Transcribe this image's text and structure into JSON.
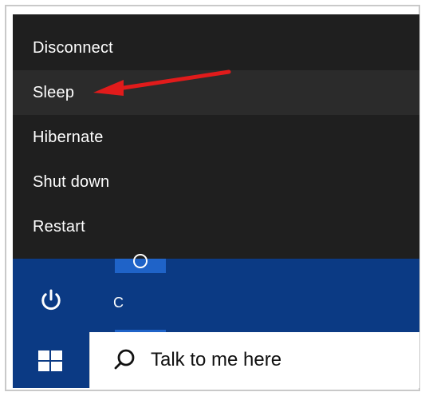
{
  "power_menu": {
    "items": [
      {
        "label": "Disconnect"
      },
      {
        "label": "Sleep"
      },
      {
        "label": "Hibernate"
      },
      {
        "label": "Shut down"
      },
      {
        "label": "Restart"
      }
    ]
  },
  "start": {
    "app_list_letter": "C"
  },
  "taskbar": {
    "search_text": "Talk to me here"
  },
  "icons": {
    "power": "power-icon",
    "windows": "windows-logo-icon",
    "search": "search-icon",
    "arrow": "red-arrow-annotation"
  },
  "colors": {
    "menu_bg": "#1f1f1f",
    "menu_highlight": "#2b2b2b",
    "taskbar_blue": "#0b3a84",
    "tile_blue": "#1f63c8",
    "arrow_red": "#e11b1b"
  }
}
